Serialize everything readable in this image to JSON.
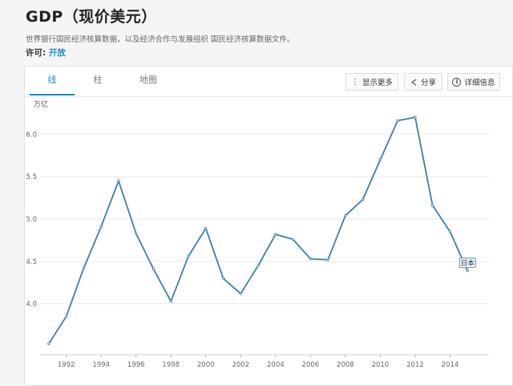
{
  "header": {
    "title": "GDP（现价美元）",
    "subtitle": "世界银行国民经济核算数据，以及经济合作与发展组织 国民经济核算数据文件。",
    "license_label": "许可:",
    "license_value": "开放"
  },
  "tabs": [
    {
      "label": "线",
      "active": true
    },
    {
      "label": "柱",
      "active": false
    },
    {
      "label": "地图",
      "active": false
    }
  ],
  "toolbar": {
    "more_label": "显示更多",
    "share_label": "分享",
    "details_label": "详细信息"
  },
  "colors": {
    "line": "#3d7fa6",
    "accent": "#1a8fc9",
    "grid": "#e8e8e8"
  },
  "chart_data": {
    "type": "line",
    "title": "",
    "xlabel": "",
    "ylabel": "万亿",
    "ylim": [
      3.4,
      6.4
    ],
    "yticks": [
      4.0,
      4.5,
      5.0,
      5.5,
      6.0
    ],
    "ytick_labels": [
      "4.0",
      "4.5",
      "5.0",
      "5.5",
      "6.0"
    ],
    "xlim": [
      1990.5,
      2016
    ],
    "xticks": [
      1992,
      1994,
      1996,
      1998,
      2000,
      2002,
      2004,
      2006,
      2008,
      2010,
      2012,
      2014
    ],
    "grid": true,
    "series": [
      {
        "name": "日本",
        "x": [
          1991,
          1992,
          1993,
          1994,
          1995,
          1996,
          1997,
          1998,
          1999,
          2000,
          2001,
          2002,
          2003,
          2004,
          2005,
          2006,
          2007,
          2008,
          2009,
          2010,
          2011,
          2012,
          2013,
          2014,
          2015
        ],
        "values": [
          3.53,
          3.85,
          4.42,
          4.91,
          5.45,
          4.83,
          4.41,
          4.03,
          4.56,
          4.89,
          4.3,
          4.12,
          4.45,
          4.82,
          4.76,
          4.53,
          4.52,
          5.04,
          5.23,
          5.7,
          6.16,
          6.2,
          5.16,
          4.85,
          4.39
        ]
      }
    ]
  }
}
